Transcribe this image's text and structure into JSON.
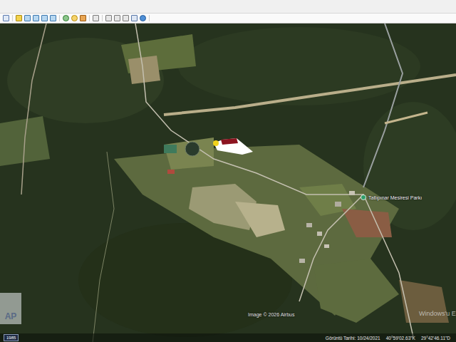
{
  "map": {
    "place_label": "Tatlıpınar Mesiresi Parkı",
    "attribution": "Image © 2026 Airbus",
    "logo": "AP",
    "watermark": "Windows'u E"
  },
  "status_bar": {
    "altitude": "1985",
    "image_date": "Görüntü Tarihi: 10/24/2021",
    "latitude": "40°59'02.63\"K",
    "longitude": "29°42'46.11\"D"
  }
}
